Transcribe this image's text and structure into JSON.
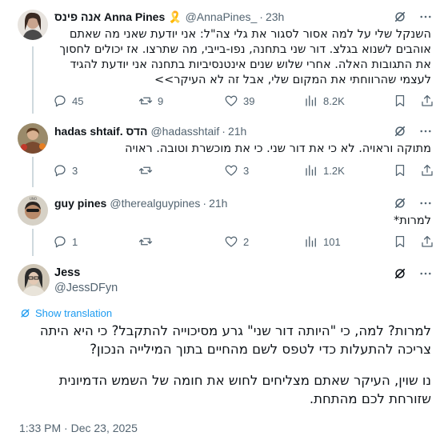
{
  "replies": [
    {
      "name": "אנה פינס Anna Pines 🎗️",
      "handle": "@AnnaPines_",
      "time": "23h",
      "text": "השנקל שלי על למה אסור לסגור את גלי צה\"ל: אני יודעת שאני מה שאתם אוהבים לשנוא בגלצ. דור שני בתחנה, נפו-בייבי, מה שתרצו. אז יכולים לחסוך את התגובות האלה. אחרי שלוש שנים אינטנסיביות בתחנה אני יודעת להגיד לעצמי שהרווחתי את המקום שלי, אבל זה לא העיקר>>",
      "replies": "45",
      "reposts": "9",
      "likes": "39",
      "views": "8.2K"
    },
    {
      "name": "hadas shtaif. הדס",
      "handle": "@hadasshtaif",
      "time": "21h",
      "text": "מתוקה וראויה. לא כי את דור שני. כי את מוכשרת וטובה. ראויה",
      "replies": "3",
      "reposts": "",
      "likes": "3",
      "views": "1.2K"
    },
    {
      "name": "guy pines",
      "handle": "@therealguypines",
      "time": "21h",
      "text": "למרות*",
      "replies": "1",
      "reposts": "",
      "likes": "2",
      "views": "101"
    }
  ],
  "main": {
    "name": "Jess",
    "handle": "@JessDFyn",
    "show_translation": "Show translation",
    "text_p1": "למרות? למה, כי \"היותה דור שני\" גרע מסיכוייה להתקבל? כי היא היתה צריכה להתעלות כדי לטפס לשם מהחיים בתוך המילייה הנכון?",
    "text_p2": "נו שוין, העיקר שאתם מצליחים לחוש את חומה של השמש הדמיונית שזורחת לכם מהתחת.",
    "timestamp": "1:33 PM · Dec 23, 2025"
  }
}
